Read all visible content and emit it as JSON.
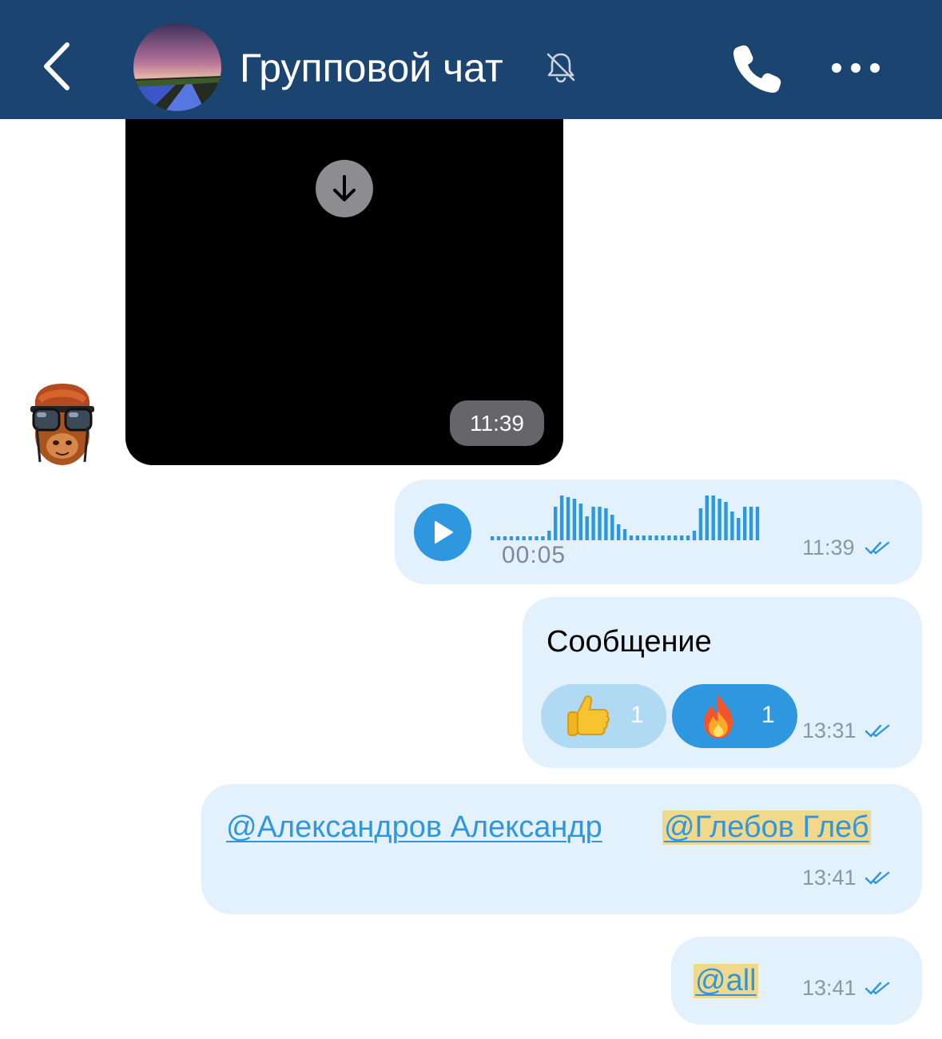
{
  "header": {
    "title": "Групповой чат",
    "muted": true,
    "colors": {
      "background": "#1c4470",
      "text": "#ffffff"
    },
    "icons": [
      "back-chevron-icon",
      "group-avatar",
      "bell-muted-icon",
      "phone-icon",
      "more-dots-icon"
    ]
  },
  "video_message": {
    "time": "11:39",
    "icon": "download-arrow-icon"
  },
  "voice_message": {
    "duration": "00:05",
    "time": "11:39",
    "status": "read",
    "icon": "play-icon",
    "accent": "#2f97e0"
  },
  "text_message": {
    "text": "Сообщение",
    "time": "13:31",
    "status": "read",
    "reactions": [
      {
        "emoji": "👍",
        "icon": "thumbs-up-icon",
        "count": "1"
      },
      {
        "emoji": "🔥",
        "icon": "fire-icon",
        "count": "1"
      }
    ]
  },
  "mention_message": {
    "mention1": "@Александров Александр",
    "mention2": "@Глебов Глеб",
    "time": "13:41",
    "status": "read"
  },
  "all_message": {
    "mention": "@all",
    "time": "13:41",
    "status": "read"
  },
  "colors": {
    "outgoing_bubble": "#e2f1fb",
    "mention_link": "#2f97e0",
    "mention_highlight": "#f0d98a"
  }
}
